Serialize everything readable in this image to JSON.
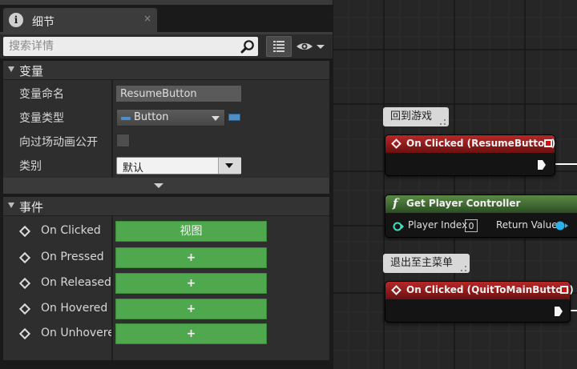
{
  "details": {
    "tab": {
      "label": "细节",
      "icon": "info-icon",
      "close_glyph": "×"
    },
    "search": {
      "placeholder": "搜索详情",
      "icon": "search-icon"
    },
    "toolbar": {
      "grid_icon": "property-matrix-icon",
      "eye_icon": "visibility-eye-icon"
    },
    "variable_section": {
      "title": "变量",
      "rows": {
        "name": {
          "label": "变量命名",
          "value": "ResumeButton"
        },
        "type": {
          "label": "变量类型",
          "value": "Button",
          "pill_color": "#4d8fc8"
        },
        "expose": {
          "label": "向过场动画公开",
          "checked": false
        },
        "category": {
          "label": "类别",
          "value": "默认"
        }
      }
    },
    "event_section": {
      "title": "事件",
      "events": [
        {
          "label": "On Clicked",
          "button": "视图"
        },
        {
          "label": "On Pressed",
          "button": "+"
        },
        {
          "label": "On Released",
          "button": "+"
        },
        {
          "label": "On Hovered",
          "button": "+"
        },
        {
          "label": "On Unhovered",
          "button": "+"
        }
      ]
    }
  },
  "graph": {
    "comment_resume": "回到游戏",
    "comment_quit": "退出至主菜单",
    "node_resume": {
      "title": "On Clicked (ResumeButton)"
    },
    "node_controller": {
      "icon": "f",
      "title": "Get Player Controller",
      "input_label": "Player Index",
      "input_value": "0",
      "output_label": "Return Value"
    },
    "node_quit": {
      "title": "On Clicked (QuitToMainButton)"
    }
  },
  "colors": {
    "event_button": "#4fa84e",
    "event_node_header": "#b62828",
    "function_node_header": "#5a8a45",
    "object_pin": "#2bb0e8",
    "int_pin": "#3fe0c0"
  }
}
